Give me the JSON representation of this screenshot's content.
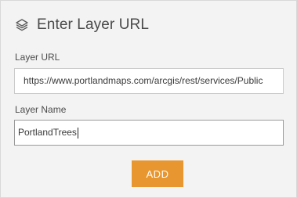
{
  "dialog": {
    "title": "Enter Layer URL",
    "icon": "layers-icon"
  },
  "layer_url": {
    "label": "Layer URL",
    "value": "https://www.portlandmaps.com/arcgis/rest/services/Public"
  },
  "layer_name": {
    "label": "Layer Name",
    "value": "PortlandTrees"
  },
  "actions": {
    "add_label": "ADD"
  },
  "colors": {
    "panel_background": "#f3f3f3",
    "button_accent": "#e89630",
    "title_text": "#4a4a4a"
  }
}
